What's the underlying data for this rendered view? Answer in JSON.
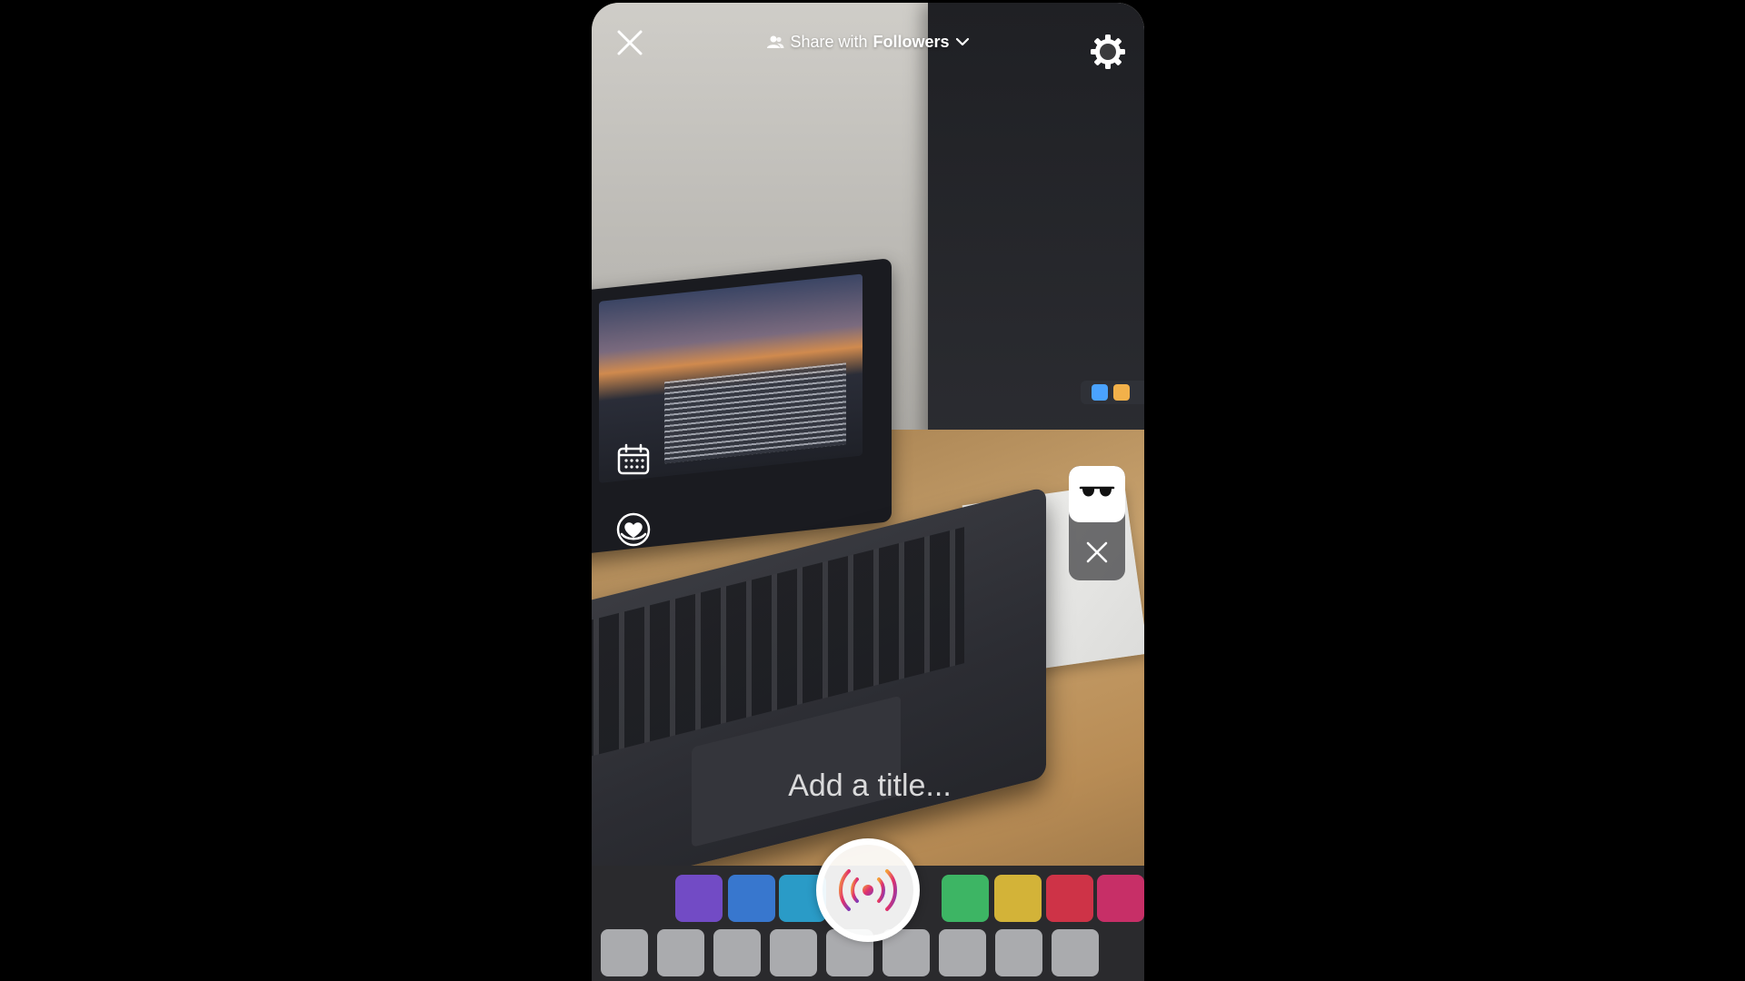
{
  "header": {
    "share_prefix": "Share with",
    "share_audience": "Followers"
  },
  "title_field": {
    "placeholder": "Add a title..."
  },
  "icons": {
    "close": "close-icon",
    "audience": "people-icon",
    "dropdown": "chevron-down-icon",
    "settings": "gear-icon",
    "schedule": "calendar-icon",
    "fundraiser": "heart-badge-icon",
    "effect": "glasses-icon",
    "remove_effect": "close-icon",
    "live": "live-broadcast-icon"
  },
  "colors": {
    "live_gradient_start": "#f4a03a",
    "live_gradient_mid": "#e1306c",
    "live_gradient_end": "#833ab4",
    "overlay_text": "#ffffff"
  }
}
